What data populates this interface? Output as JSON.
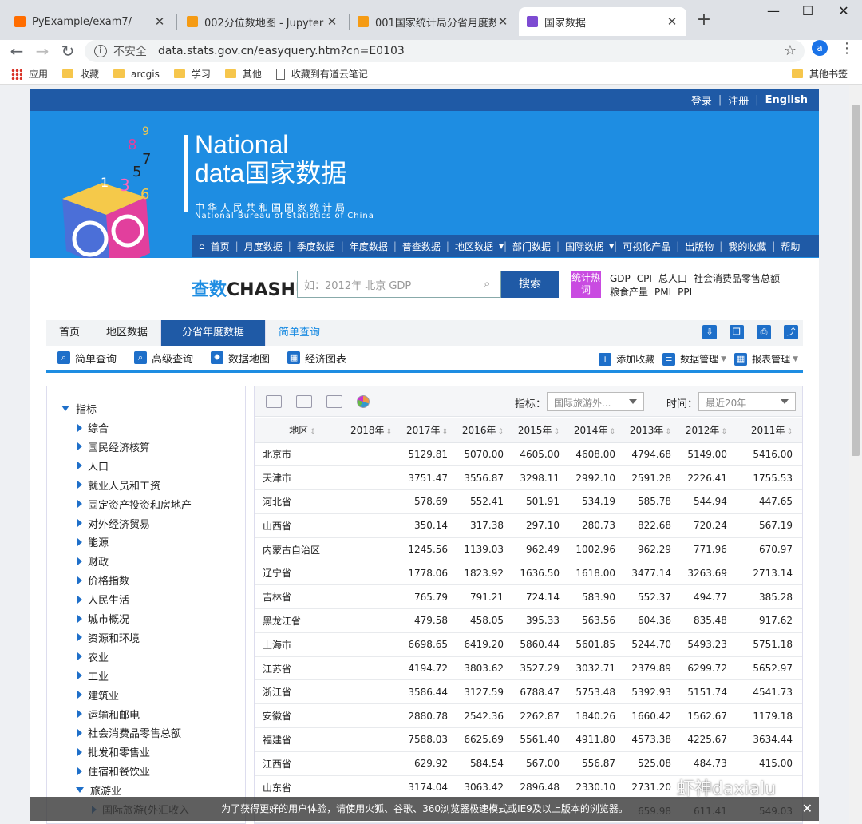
{
  "browser": {
    "tabs": [
      {
        "label": "PyExample/exam7/",
        "close": "✕",
        "active": false,
        "color": "#ff6d00"
      },
      {
        "label": "002分位数地图 - Jupyter N",
        "close": "✕",
        "active": false,
        "color": "#f59b14"
      },
      {
        "label": "001国家统计局分省月度数据",
        "close": "✕",
        "active": false,
        "color": "#f59b14"
      },
      {
        "label": "国家数据",
        "close": "✕",
        "active": true,
        "color": "#7d4bd2"
      }
    ],
    "new_tab": "+",
    "window_controls": [
      "—",
      "☐",
      "✕"
    ],
    "insecure_label": "不安全",
    "url": "data.stats.gov.cn/easyquery.htm?cn=E0103",
    "avatar": "a",
    "bookmarks": [
      "应用",
      "收藏",
      "arcgis",
      "学习",
      "其他",
      "收藏到有道云笔记"
    ],
    "other_bookmarks": "其他书签"
  },
  "site": {
    "toplinks": [
      "登录",
      "注册",
      "English"
    ],
    "logo": {
      "line1": "National",
      "line2": "data国家数据",
      "cn": "中华人民共和国国家统计局",
      "en": "National Bureau of Statistics of China"
    },
    "nav": [
      "首页",
      "月度数据",
      "季度数据",
      "年度数据",
      "普查数据",
      "地区数据",
      "部门数据",
      "国际数据",
      "可视化产品",
      "出版物",
      "我的收藏",
      "帮助"
    ],
    "chashu_cn": "查数",
    "chashu_en": "CHASHU",
    "search_placeholder": "如：2012年 北京 GDP",
    "search_button": "搜索",
    "hot_label": "统计热词",
    "hot_words": [
      "GDP",
      "CPI",
      "总人口",
      "社会消费品零售总额",
      "粮食产量",
      "PMI",
      "PPI"
    ],
    "breadcrumb": [
      "首页",
      "地区数据",
      "分省年度数据",
      "简单查询"
    ],
    "tools": [
      "简单查询",
      "高级查询",
      "数据地图",
      "经济图表"
    ],
    "tools_right": [
      "添加收藏",
      "数据管理",
      "报表管理"
    ],
    "tree_root": "指标",
    "tree_items": [
      "综合",
      "国民经济核算",
      "人口",
      "就业人员和工资",
      "固定资产投资和房地产",
      "对外经济贸易",
      "能源",
      "财政",
      "价格指数",
      "人民生活",
      "城市概况",
      "资源和环境",
      "农业",
      "工业",
      "建筑业",
      "运输和邮电",
      "社会消费品零售总额",
      "批发和零售业",
      "住宿和餐饮业"
    ],
    "tree_open": "旅游业",
    "tree_sub": "国际旅游(外汇收入",
    "indicator_label": "指标：",
    "indicator_value": "国际旅游外...",
    "time_label": "时间：",
    "time_value": "最近20年",
    "columns": [
      "地区",
      "2018年",
      "2017年",
      "2016年",
      "2015年",
      "2014年",
      "2013年",
      "2012年",
      "2011年"
    ],
    "rows": [
      [
        "北京市",
        "",
        "5129.81",
        "5070.00",
        "4605.00",
        "4608.00",
        "4794.68",
        "5149.00",
        "5416.00"
      ],
      [
        "天津市",
        "",
        "3751.47",
        "3556.87",
        "3298.11",
        "2992.10",
        "2591.28",
        "2226.41",
        "1755.53"
      ],
      [
        "河北省",
        "",
        "578.69",
        "552.41",
        "501.91",
        "534.19",
        "585.78",
        "544.94",
        "447.65"
      ],
      [
        "山西省",
        "",
        "350.14",
        "317.38",
        "297.10",
        "280.73",
        "822.68",
        "720.24",
        "567.19"
      ],
      [
        "内蒙古自治区",
        "",
        "1245.56",
        "1139.03",
        "962.49",
        "1002.96",
        "962.29",
        "771.96",
        "670.97"
      ],
      [
        "辽宁省",
        "",
        "1778.06",
        "1823.92",
        "1636.50",
        "1618.00",
        "3477.14",
        "3263.69",
        "2713.14"
      ],
      [
        "吉林省",
        "",
        "765.79",
        "791.21",
        "724.14",
        "583.90",
        "552.37",
        "494.77",
        "385.28"
      ],
      [
        "黑龙江省",
        "",
        "479.58",
        "458.05",
        "395.33",
        "563.56",
        "604.36",
        "835.48",
        "917.62"
      ],
      [
        "上海市",
        "",
        "6698.65",
        "6419.20",
        "5860.44",
        "5601.85",
        "5244.70",
        "5493.23",
        "5751.18"
      ],
      [
        "江苏省",
        "",
        "4194.72",
        "3803.62",
        "3527.29",
        "3032.71",
        "2379.89",
        "6299.72",
        "5652.97"
      ],
      [
        "浙江省",
        "",
        "3586.44",
        "3127.59",
        "6788.47",
        "5753.48",
        "5392.93",
        "5151.74",
        "4541.73"
      ],
      [
        "安徽省",
        "",
        "2880.78",
        "2542.36",
        "2262.87",
        "1840.26",
        "1660.42",
        "1562.67",
        "1179.18"
      ],
      [
        "福建省",
        "",
        "7588.03",
        "6625.69",
        "5561.40",
        "4911.80",
        "4573.38",
        "4225.67",
        "3634.44"
      ],
      [
        "江西省",
        "",
        "629.92",
        "584.54",
        "567.00",
        "556.87",
        "525.08",
        "484.73",
        "415.00"
      ],
      [
        "山东省",
        "",
        "3174.04",
        "3063.42",
        "2896.48",
        "2330.10",
        "2731.20",
        "",
        ""
      ],
      [
        "",
        "",
        "",
        "",
        "",
        "",
        "659.98",
        "611.41",
        "549.03"
      ]
    ],
    "notice": "为了获得更好的用户体验，请使用火狐、谷歌、360浏览器极速模式或IE9及以上版本的浏览器。",
    "notice_close": "✕",
    "watermark": "虾神daxialu"
  }
}
